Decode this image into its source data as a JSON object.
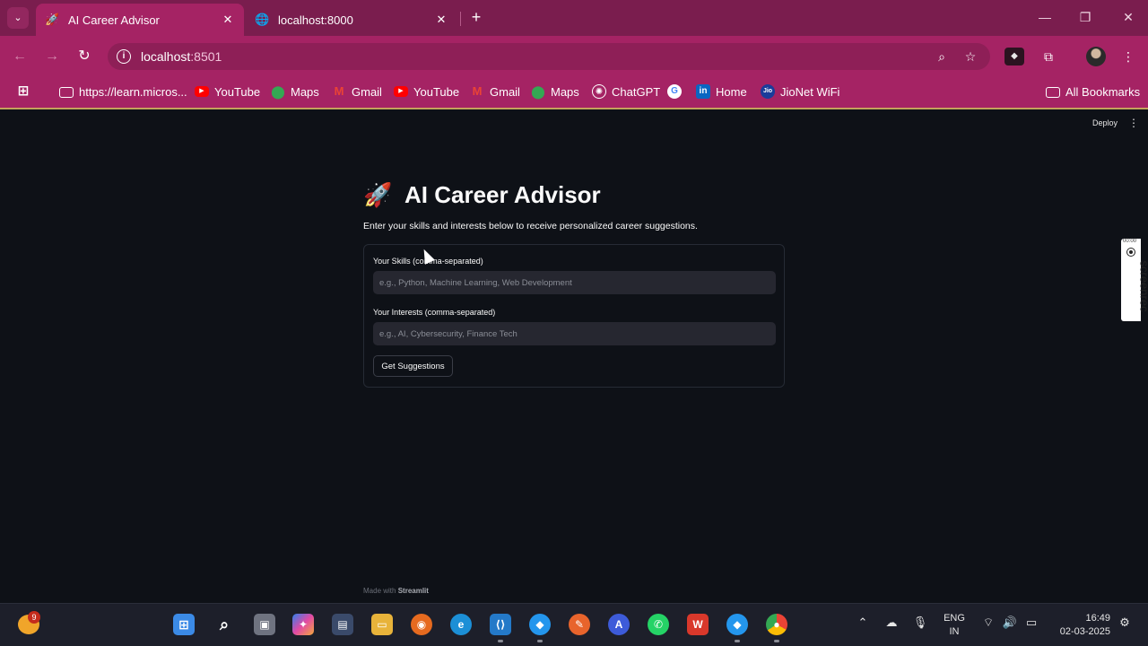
{
  "browser": {
    "tabs": [
      {
        "title": "AI Career Advisor",
        "favicon": "rocket-icon",
        "active": true
      },
      {
        "title": "localhost:8000",
        "favicon": "globe-icon",
        "active": false
      }
    ],
    "url_host": "localhost",
    "url_port": ":8501",
    "bookmarks": [
      {
        "label": "https://learn.micros...",
        "icon": "folder-icon"
      },
      {
        "label": "YouTube",
        "icon": "youtube-icon"
      },
      {
        "label": "Maps",
        "icon": "maps-icon"
      },
      {
        "label": "Gmail",
        "icon": "gmail-icon"
      },
      {
        "label": "YouTube",
        "icon": "youtube-icon"
      },
      {
        "label": "Gmail",
        "icon": "gmail-icon"
      },
      {
        "label": "Maps",
        "icon": "maps-icon"
      },
      {
        "label": "ChatGPT",
        "icon": "chatgpt-icon"
      },
      {
        "label": "",
        "icon": "google-icon"
      },
      {
        "label": "Home",
        "icon": "linkedin-icon"
      },
      {
        "label": "JioNet WiFi",
        "icon": "jio-icon"
      }
    ],
    "all_bookmarks_label": "All Bookmarks"
  },
  "app": {
    "deploy_label": "Deploy",
    "title": "AI Career Advisor",
    "subtitle": "Enter your skills and interests below to receive personalized career suggestions.",
    "skills_label": "Your Skills (comma-separated)",
    "skills_placeholder": "e.g., Python, Machine Learning, Web Development",
    "skills_value": "",
    "interests_label": "Your Interests (comma-separated)",
    "interests_placeholder": "e.g., AI, Cybersecurity, Finance Tech",
    "interests_value": "",
    "button_label": "Get Suggestions",
    "footer_prefix": "Made with",
    "footer_brand": "Streamlit"
  },
  "overlay": {
    "screenrec_time": "00:00",
    "screenrec_label": "screenrec"
  },
  "taskbar": {
    "weather_badge": "9",
    "language_line1": "ENG",
    "language_line2": "IN",
    "time": "16:49",
    "date": "02-03-2025"
  },
  "colors": {
    "tab_bar": "#7a1d4e",
    "toolbar": "#a52364",
    "app_background": "#0e1117",
    "input_background": "#262730",
    "text": "#fafafa"
  }
}
